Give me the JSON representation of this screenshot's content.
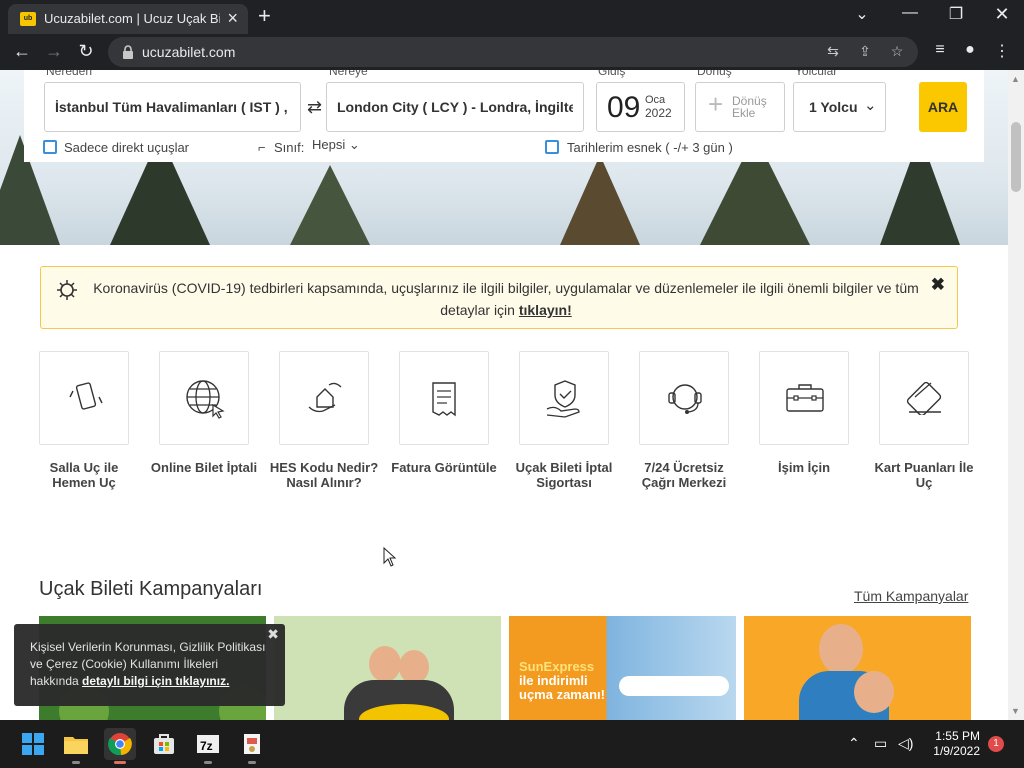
{
  "browser": {
    "tab_title": "Ucuzabilet.com | Ucuz Uçak Bileti",
    "url": "ucuzabilet.com",
    "favicon_text": "ub"
  },
  "search": {
    "from_label": "Nereden",
    "from_value": "İstanbul Tüm Havalimanları ( IST ) ,",
    "to_label": "Nereye",
    "to_value": "London City ( LCY ) - Londra, İngiltere",
    "depart_label": "Gidiş",
    "depart_day": "09",
    "depart_month": "Oca",
    "depart_year": "2022",
    "return_label": "Dönüş",
    "return_text": "Dönüş Ekle",
    "passenger_label": "Yolcular",
    "passenger_value": "1 Yolcu",
    "search_button": "ARA",
    "direct_only": "Sadece direkt uçuşlar",
    "class_label": "Sınıf:",
    "class_value": "Hepsi",
    "flexible_dates": "Tarihlerim esnek ( -/+ 3 gün )"
  },
  "covid": {
    "text": "Koronavirüs (COVID-19) tedbirleri kapsamında, uçuşlarınız ile ilgili bilgiler, uygulamalar ve düzenlemeler ile ilgili önemli bilgiler ve tüm detaylar için ",
    "link": "tıklayın!"
  },
  "quick_links": [
    {
      "label": "Salla Uç ile Hemen Uç",
      "icon": "phone-shake-icon"
    },
    {
      "label": "Online Bilet İptali",
      "icon": "globe-cursor-icon"
    },
    {
      "label": "HES Kodu Nedir? Nasıl Alınır?",
      "icon": "house-hand-icon"
    },
    {
      "label": "Fatura Görüntüle",
      "icon": "invoice-icon"
    },
    {
      "label": "Uçak Bileti İptal Sigortası",
      "icon": "shield-hand-icon"
    },
    {
      "label": "7/24 Ücretsiz Çağrı Merkezi",
      "icon": "headset-icon"
    },
    {
      "label": "İşim İçin",
      "icon": "briefcase-icon"
    },
    {
      "label": "Kart Puanları İle Uç",
      "icon": "card-icon"
    }
  ],
  "campaigns": {
    "title": "Uçak Bileti Kampanyaları",
    "all_link": "Tüm Kampanyalar",
    "sunexpress_line1": "SunExpress",
    "sunexpress_line2": "ile indirimli uçma zamanı!"
  },
  "cookie": {
    "text": "Kişisel Verilerin Korunması, Gizlilik Politikası ve Çerez (Cookie) Kullanımı İlkeleri hakkında ",
    "link": "detaylı bilgi için tıklayınız."
  },
  "taskbar": {
    "time": "1:55 PM",
    "date": "1/9/2022",
    "notifications": "1"
  },
  "colors": {
    "accent_yellow": "#fbc800",
    "checkbox_blue": "#3a8fd8",
    "covid_border": "#f2c94c"
  }
}
